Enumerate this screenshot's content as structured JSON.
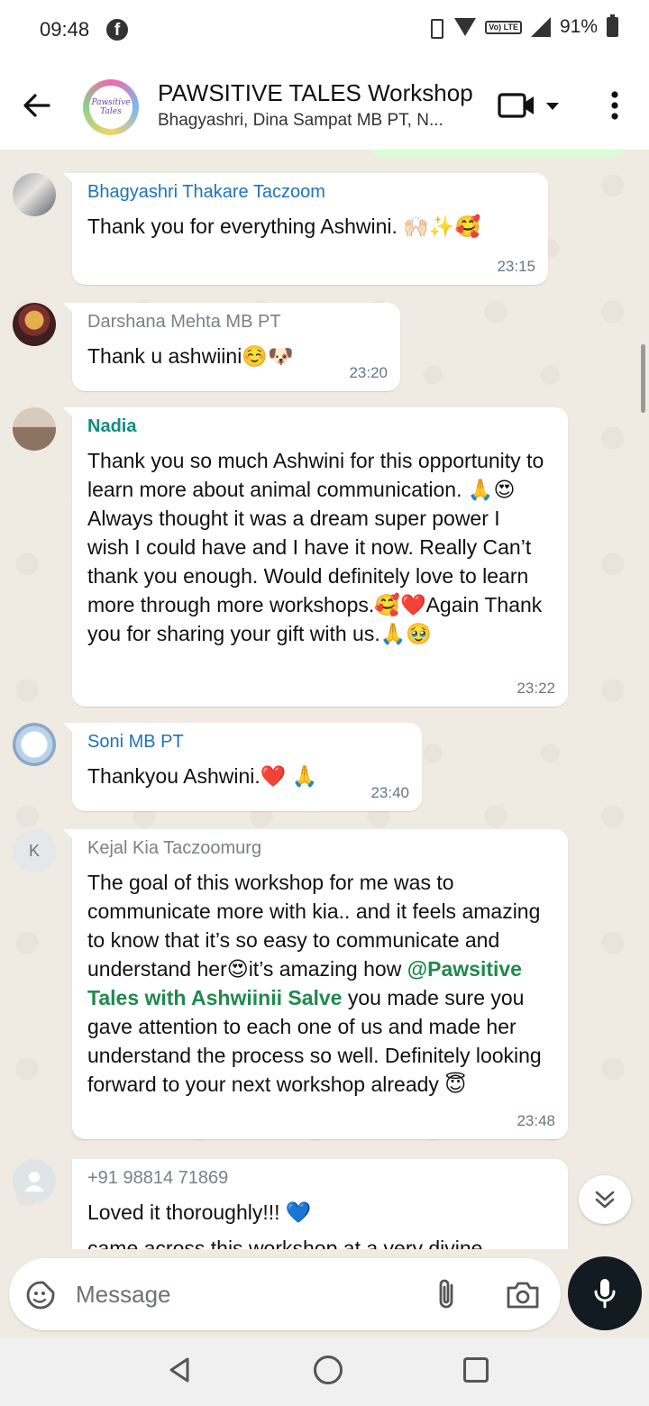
{
  "status_bar": {
    "time": "09:48",
    "battery": "91%",
    "volte": "Vo) LTE"
  },
  "header": {
    "title": "PAWSITIVE TALES Workshop",
    "subtitle": "Bhagyashri, Dina Sampat MB PT, N...",
    "avatar_text": "Pawsitive Tales"
  },
  "messages": [
    {
      "sender": "Bhagyashri Thakare Taczoom",
      "sender_color": "#1d73b8",
      "text": "Thank you for everything Ashwini. 🙌🏻✨🥰",
      "time": "23:15"
    },
    {
      "sender": "Darshana Mehta MB PT",
      "sender_color": "#7b8088",
      "text": "Thank u ashwiini☺️🐶",
      "time": "23:20"
    },
    {
      "sender": "Nadia",
      "sender_color": "#128c7e",
      "text": "Thank you so much Ashwini for this opportunity to learn more about animal communication. 🙏😍Always thought it was a dream super power I wish I could have and I have it now. Really Can’t thank you enough. Would definitely love to learn more through more workshops.🥰❤️Again Thank you for sharing your gift with us.🙏🥹",
      "time": "23:22"
    },
    {
      "sender": "Soni MB PT",
      "sender_color": "#1d73b8",
      "text": "Thankyou Ashwini.❤️ 🙏",
      "time": "23:40"
    },
    {
      "sender": "Kejal Kia Taczoomurg",
      "sender_color": "#7b8088",
      "avatar_letter": "K",
      "text_before": "The goal of this workshop for me was to communicate more with kia.. and it feels amazing to know that it’s so easy to communicate and understand her😍it’s amazing how ",
      "mention": "@Pawsitive Tales with Ashwiinii Salve",
      "text_after": " you made sure you gave attention to each one of us and made her understand the process so well. Definitely looking forward to your next workshop already 😇",
      "time": "23:48"
    },
    {
      "sender": "+91 98814 71869",
      "sender_color": "#7b8088",
      "text": "Loved it thoroughly!!! 💙",
      "text_cut": "came across this workshop at a very divine"
    }
  ],
  "composer": {
    "placeholder": "Message"
  },
  "icons": {
    "back": "back-arrow-icon",
    "video": "video-call-icon",
    "menu": "more-vert-icon",
    "sticker": "sticker-icon",
    "attach": "paperclip-icon",
    "camera": "camera-icon",
    "mic": "microphone-icon",
    "scroll": "double-chevron-down-icon"
  },
  "colors": {
    "chat_bg": "#efeae2",
    "bubble": "#ffffff",
    "mention": "#1f8a4c",
    "time": "#667781",
    "mic_bg": "#111b21"
  }
}
